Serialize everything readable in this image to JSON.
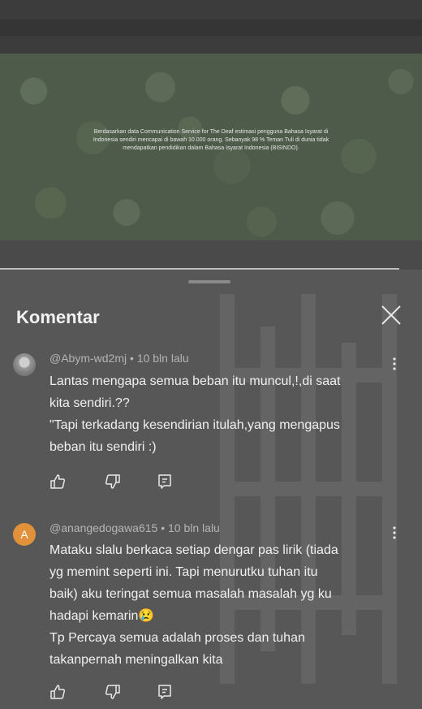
{
  "video": {
    "caption": "Berdasarkan data Communication Service for The Deaf estimasi pengguna Bahasa Isyarat di Indonesia sendiri mencapai di bawah 10.000 orang. Sebanyak 98 % Teman Tuli di dunia tidak mendapatkan pendidikan dalam Bahasa Isyarat Indonesia (BISINDO)."
  },
  "comments_panel": {
    "title": "Komentar",
    "close_icon": "close-icon"
  },
  "comments": [
    {
      "author": "@Abym-wd2mj",
      "age": "10 bln lalu",
      "avatar": "photo",
      "text": "Lantas mengapa semua beban itu muncul,!,di saat\nkita sendiri.??\n\"Tapi terkadang kesendirian itulah,yang mengapus\nbeban itu sendiri :)"
    },
    {
      "author": "@anangedogawa615",
      "age": "10 bln lalu",
      "avatar_letter": "A",
      "text": "Mataku slalu berkaca setiap dengar pas lirik (tiada\nyg memint seperti ini. Tapi menurutku tuhan itu\nbaik) aku teringat semua masalah masalah yg ku\nhadapi kemarin😢\nTp Percaya semua adalah proses dan tuhan\ntakanpernah meningalkan kita"
    }
  ],
  "icons": {
    "like": "thumbs-up-icon",
    "dislike": "thumbs-down-icon",
    "reply": "reply-icon",
    "more": "more-vertical-icon"
  },
  "colors": {
    "avatar_letter_bg": "#e0913a"
  }
}
